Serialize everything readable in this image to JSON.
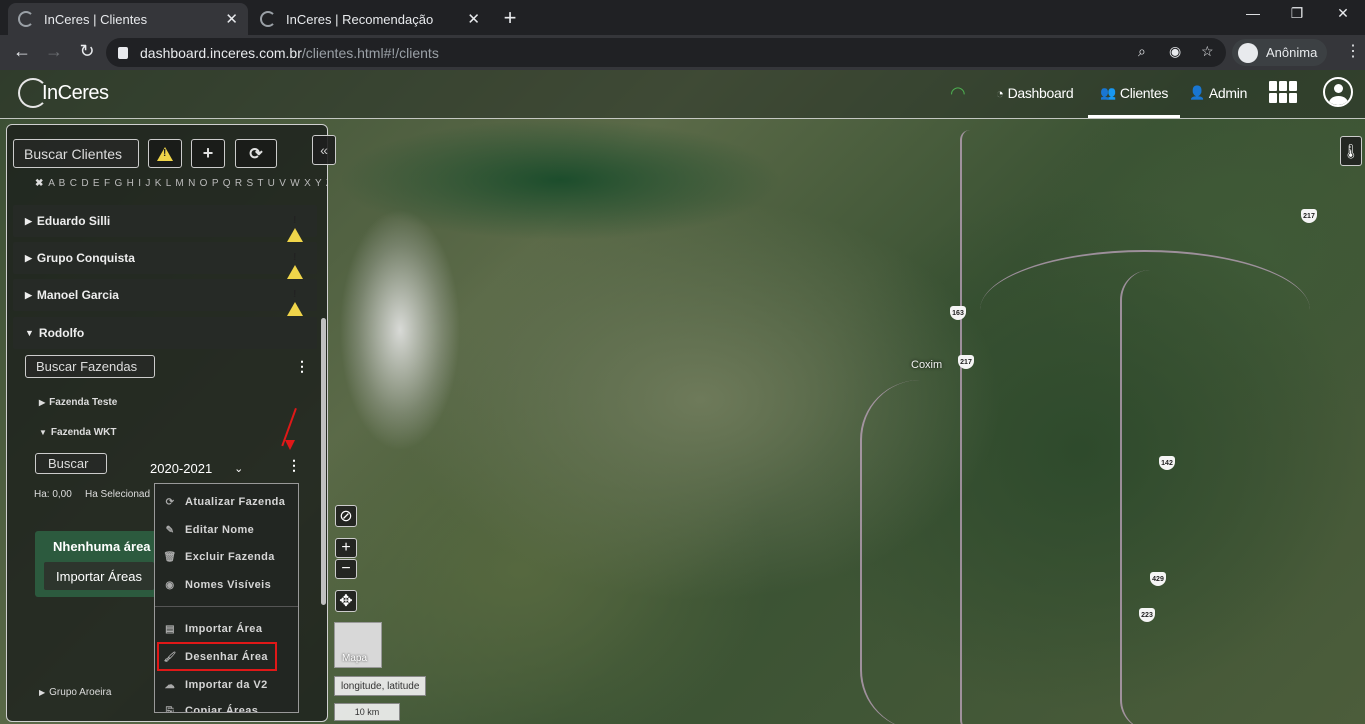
{
  "browser": {
    "tabs": [
      {
        "title": "InCeres | Clientes",
        "active": true
      },
      {
        "title": "InCeres | Recomendação",
        "active": false
      }
    ],
    "url_host": "dashboard.inceres.com.br",
    "url_path": "/clientes.html#!/clients",
    "profile_label": "Anônima",
    "new_tab": "+",
    "window_min": "—",
    "window_restore": "❐",
    "window_close": "✕",
    "close_tab": "✕"
  },
  "header": {
    "logo": "InCeres",
    "nav": {
      "dashboard": "Dashboard",
      "clientes": "Clientes",
      "admin": "Admin"
    },
    "active_nav": "Clientes"
  },
  "sidebar": {
    "search_clients_placeholder": "Buscar Clientes",
    "alphabet_clear": "✖",
    "alphabet": "A B C D E F G H I J K L M N O P Q R S T U V W X Y Z",
    "clients": [
      {
        "name": "Eduardo Silli",
        "expanded": false,
        "warning": true
      },
      {
        "name": "Grupo Conquista",
        "expanded": false,
        "warning": true
      },
      {
        "name": "Manoel Garcia",
        "expanded": false,
        "warning": true
      },
      {
        "name": "Rodolfo",
        "expanded": true,
        "warning": false
      }
    ],
    "search_farms_placeholder": "Buscar Fazendas",
    "farms": [
      {
        "name": "Fazenda Teste",
        "expanded": false
      },
      {
        "name": "Fazenda WKT",
        "expanded": true
      }
    ],
    "search_button": "Buscar",
    "season": "2020-2021",
    "ha_total": "Ha: 0,00",
    "ha_selected": "Ha Selecionad",
    "empty_message": "Nhenhuma área en",
    "import_areas": "Importar Áreas",
    "last_farm_group": "Grupo Aroeira"
  },
  "dropdown": {
    "items": [
      {
        "label": "Atualizar Fazenda",
        "icon": "refresh-icon"
      },
      {
        "label": "Editar Nome",
        "icon": "pencil-icon"
      },
      {
        "label": "Excluir Fazenda",
        "icon": "trash-icon"
      },
      {
        "label": "Nomes Visíveis",
        "icon": "eye-icon"
      },
      {
        "label": "Importar Área",
        "icon": "file-import-icon"
      },
      {
        "label": "Desenhar Área",
        "icon": "brush-icon"
      },
      {
        "label": "Importar da V2",
        "icon": "cloud-upload-icon"
      },
      {
        "label": "Copiar Áreas",
        "icon": "copy-icon"
      }
    ],
    "highlighted": "Desenhar Área"
  },
  "map": {
    "basemap_label": "Mapa",
    "coords_label": "longitude, latitude",
    "scale_label": "10 km",
    "city_label": "Coxim",
    "road_shields": [
      "163",
      "217",
      "217",
      "142",
      "429",
      "223"
    ],
    "zoom_in": "+",
    "zoom_out": "−"
  },
  "colors": {
    "accent_green": "#4caf50",
    "highlight_red": "#e01818",
    "warning_yellow": "#f0d54a"
  }
}
